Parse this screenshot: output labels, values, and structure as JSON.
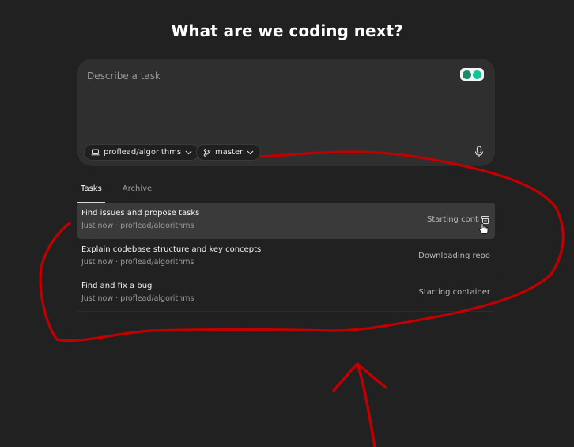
{
  "page": {
    "title": "What are we coding next?"
  },
  "composer": {
    "placeholder": "Describe a task",
    "repo_label": "proflead/algorithms",
    "branch_label": "master"
  },
  "tabs": [
    {
      "label": "Tasks",
      "active": true
    },
    {
      "label": "Archive",
      "active": false
    }
  ],
  "tasks": [
    {
      "title": "Find issues and propose tasks",
      "meta": "Just now · proflead/algorithms",
      "status": "Starting container"
    },
    {
      "title": "Explain codebase structure and key concepts",
      "meta": "Just now · proflead/algorithms",
      "status": "Downloading repo"
    },
    {
      "title": "Find and fix a bug",
      "meta": "Just now · proflead/algorithms",
      "status": "Starting container"
    }
  ],
  "colors": {
    "background": "#212121",
    "composer": "#2f2f2f",
    "annotation": "#c00000"
  },
  "icons": [
    "laptop-icon",
    "chevron-down-icon",
    "git-branch-icon",
    "microphone-icon",
    "archive-icon",
    "grammarly-icon",
    "hand-cursor-icon"
  ]
}
